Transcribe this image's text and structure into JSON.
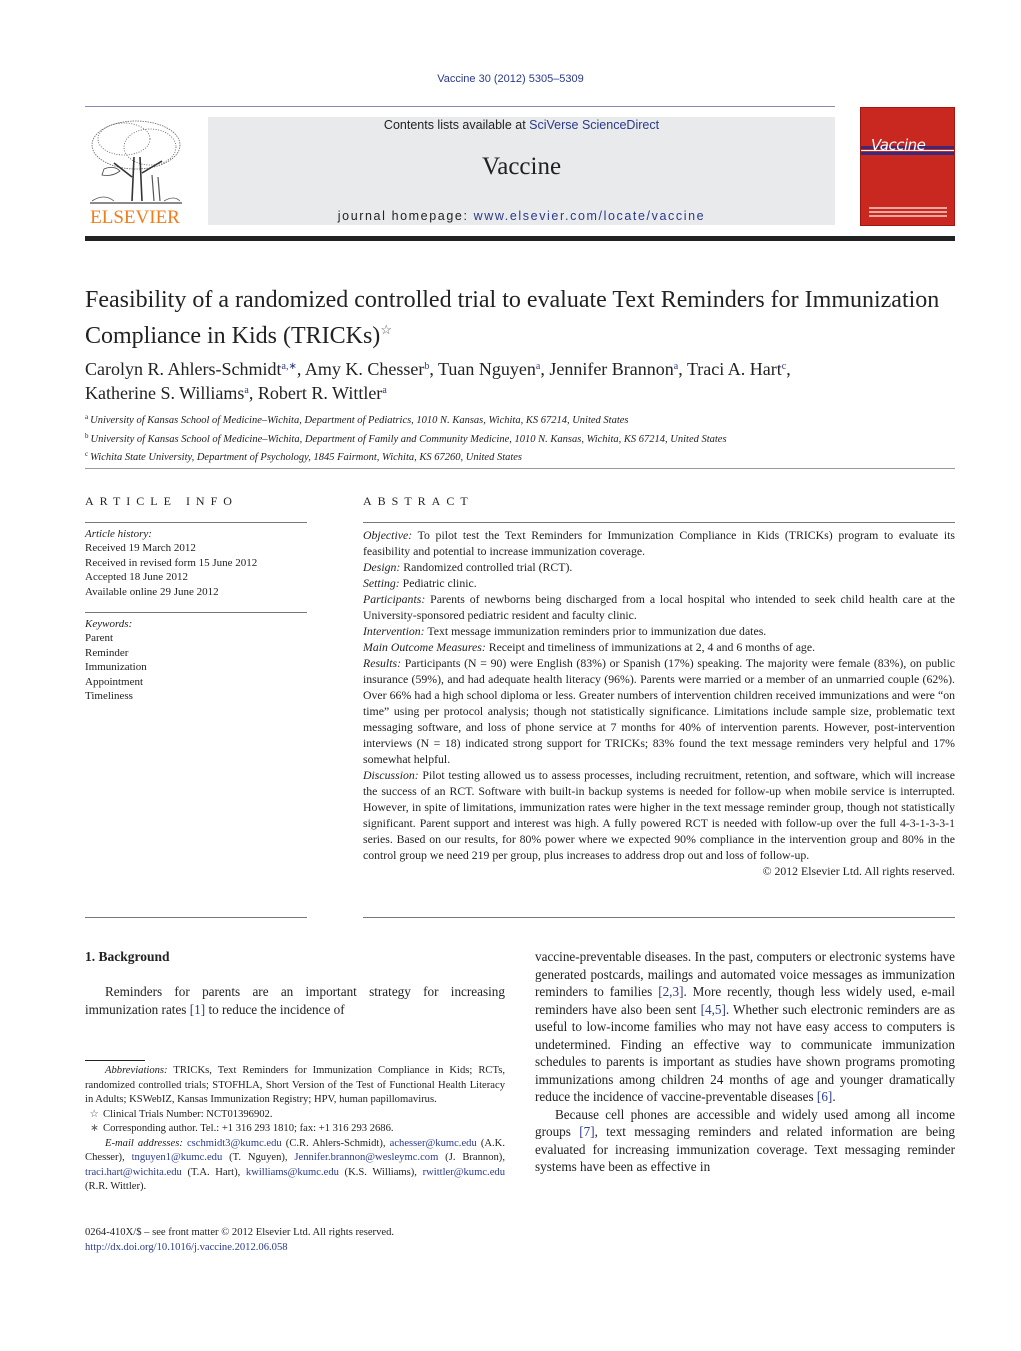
{
  "header": {
    "citation": "Vaccine 30 (2012) 5305–5309",
    "contents_prefix": "Contents lists available at ",
    "contents_link": "SciVerse ScienceDirect",
    "journal_name": "Vaccine",
    "homepage_prefix": "journal homepage: ",
    "homepage_url": "www.elsevier.com/locate/vaccine",
    "publisher_logo_text": "ELSEVIER",
    "cover_title": "Vaccine",
    "colors": {
      "publisher_orange": "#f07d1a",
      "cover_red": "#c8281f",
      "link_blue": "#2a3a8c",
      "header_gray": "#e9eaeb"
    }
  },
  "article": {
    "title": "Feasibility of a randomized controlled trial to evaluate Text Reminders for Immunization Compliance in Kids (TRICKs)",
    "title_mark": "☆",
    "authors": [
      {
        "name": "Carolyn R. Ahlers-Schmidt",
        "sup": "a,∗",
        "sep": ", "
      },
      {
        "name": "Amy K. Chesser",
        "sup": "b",
        "sep": ", "
      },
      {
        "name": "Tuan Nguyen",
        "sup": "a",
        "sep": ", "
      },
      {
        "name": "Jennifer Brannon",
        "sup": "a",
        "sep": ", "
      },
      {
        "name": "Traci A. Hart",
        "sup": "c",
        "sep": ","
      },
      {
        "name": "Katherine S. Williams",
        "sup": "a",
        "sep": ", "
      },
      {
        "name": "Robert R. Wittler",
        "sup": "a",
        "sep": ""
      }
    ],
    "affiliations": [
      {
        "mark": "a",
        "text": "University of Kansas School of Medicine–Wichita, Department of Pediatrics, 1010 N. Kansas, Wichita, KS 67214, United States"
      },
      {
        "mark": "b",
        "text": "University of Kansas School of Medicine–Wichita, Department of Family and Community Medicine, 1010 N. Kansas, Wichita, KS 67214, United States"
      },
      {
        "mark": "c",
        "text": "Wichita State University, Department of Psychology, 1845 Fairmont, Wichita, KS 67260, United States"
      }
    ]
  },
  "article_info": {
    "label": "ARTICLE INFO",
    "history_label": "Article history:",
    "history": [
      "Received 19 March 2012",
      "Received in revised form 15 June 2012",
      "Accepted 18 June 2012",
      "Available online 29 June 2012"
    ],
    "keywords_label": "Keywords:",
    "keywords": [
      "Parent",
      "Reminder",
      "Immunization",
      "Appointment",
      "Timeliness"
    ]
  },
  "abstract": {
    "label": "ABSTRACT",
    "sections": [
      {
        "label": "Objective:",
        "text": " To pilot test the Text Reminders for Immunization Compliance in Kids (TRICKs) program to evaluate its feasibility and potential to increase immunization coverage."
      },
      {
        "label": "Design:",
        "text": " Randomized controlled trial (RCT)."
      },
      {
        "label": "Setting:",
        "text": " Pediatric clinic."
      },
      {
        "label": "Participants:",
        "text": " Parents of newborns being discharged from a local hospital who intended to seek child health care at the University-sponsored pediatric resident and faculty clinic."
      },
      {
        "label": "Intervention:",
        "text": " Text message immunization reminders prior to immunization due dates."
      },
      {
        "label": "Main Outcome Measures:",
        "text": " Receipt and timeliness of immunizations at 2, 4 and 6 months of age."
      },
      {
        "label": "Results:",
        "text": " Participants (N = 90) were English (83%) or Spanish (17%) speaking. The majority were female (83%), on public insurance (59%), and had adequate health literacy (96%). Parents were married or a member of an unmarried couple (62%). Over 66% had a high school diploma or less. Greater numbers of intervention children received immunizations and were “on time” using per protocol analysis; though not statistically significance. Limitations include sample size, problematic text messaging software, and loss of phone service at 7 months for 40% of intervention parents. However, post-intervention interviews (N = 18) indicated strong support for TRICKs; 83% found the text message reminders very helpful and 17% somewhat helpful."
      },
      {
        "label": "Discussion:",
        "text": " Pilot testing allowed us to assess processes, including recruitment, retention, and software, which will increase the success of an RCT. Software with built-in backup systems is needed for follow-up when mobile service is interrupted. However, in spite of limitations, immunization rates were higher in the text message reminder group, though not statistically significant. Parent support and interest was high. A fully powered RCT is needed with follow-up over the full 4-3-1-3-3-1 series. Based on our results, for 80% power where we expected 90% compliance in the intervention group and 80% in the control group we need 219 per group, plus increases to address drop out and loss of follow-up."
      }
    ],
    "copyright": "© 2012 Elsevier Ltd. All rights reserved."
  },
  "body": {
    "section_heading": "1.  Background",
    "left_para": {
      "before": "Reminders for parents are an important strategy for increasing immunization rates ",
      "ref": "[1]",
      "after": " to reduce the incidence of"
    },
    "right_para1": [
      {
        "t": "vaccine-preventable diseases. In the past, computers or electronic systems have generated postcards, mailings and automated voice messages as immunization reminders to families "
      },
      {
        "ref": "[2,3]"
      },
      {
        "t": ". More recently, though less widely used, e-mail reminders have also been sent "
      },
      {
        "ref": "[4,5]"
      },
      {
        "t": ". Whether such electronic reminders are as useful to low-income families who may not have easy access to computers is undetermined. Finding an effective way to communicate immunization schedules to parents is important as studies have shown programs promoting immunizations among children 24 months of age and younger dramatically reduce the incidence of vaccine-preventable diseases "
      },
      {
        "ref": "[6]"
      },
      {
        "t": "."
      }
    ],
    "right_para2": [
      {
        "t": "Because cell phones are accessible and widely used among all income groups "
      },
      {
        "ref": "[7]"
      },
      {
        "t": ", text messaging reminders and related information are being evaluated for increasing immunization coverage. Text messaging reminder systems have been as effective in"
      }
    ]
  },
  "footnotes": {
    "abbrev_label": "Abbreviations:",
    "abbrev_text": "  TRICKs, Text Reminders for Immunization Compliance in Kids; RCTs, randomized controlled trials; STOFHLA, Short Version of the Test of Functional Health Literacy in Adults; KSWebIZ, Kansas Immunization Registry; HPV, human papillomavirus.",
    "trial_mark": "☆",
    "trial_text": "Clinical Trials Number: NCT01396902.",
    "corr_mark": "∗",
    "corr_text": "Corresponding author. Tel.: +1 316 293 1810; fax: +1 316 293 2686.",
    "email_label": "E-mail addresses:",
    "emails": [
      {
        "email": "cschmidt3@kumc.edu",
        "who": " (C.R. Ahlers-Schmidt),",
        "sep": " "
      },
      {
        "email": "achesser@kumc.edu",
        "who": " (A.K. Chesser), ",
        "sep": ""
      },
      {
        "email": "tnguyen1@kumc.edu",
        "who": " (T. Nguyen),",
        "sep": " "
      },
      {
        "email": "Jennifer.brannon@wesleymc.com",
        "who": " (J. Brannon), ",
        "sep": ""
      },
      {
        "email": "traci.hart@wichita.edu",
        "who": " (T.A. Hart),",
        "sep": " "
      },
      {
        "email": "kwilliams@kumc.edu",
        "who": " (K.S. Williams), ",
        "sep": ""
      },
      {
        "email": "rwittler@kumc.edu",
        "who": " (R.R. Wittler).",
        "sep": ""
      }
    ]
  },
  "front_matter": {
    "issn_line": "0264-410X/$ – see front matter © 2012 Elsevier Ltd. All rights reserved.",
    "doi": "http://dx.doi.org/10.1016/j.vaccine.2012.06.058"
  }
}
